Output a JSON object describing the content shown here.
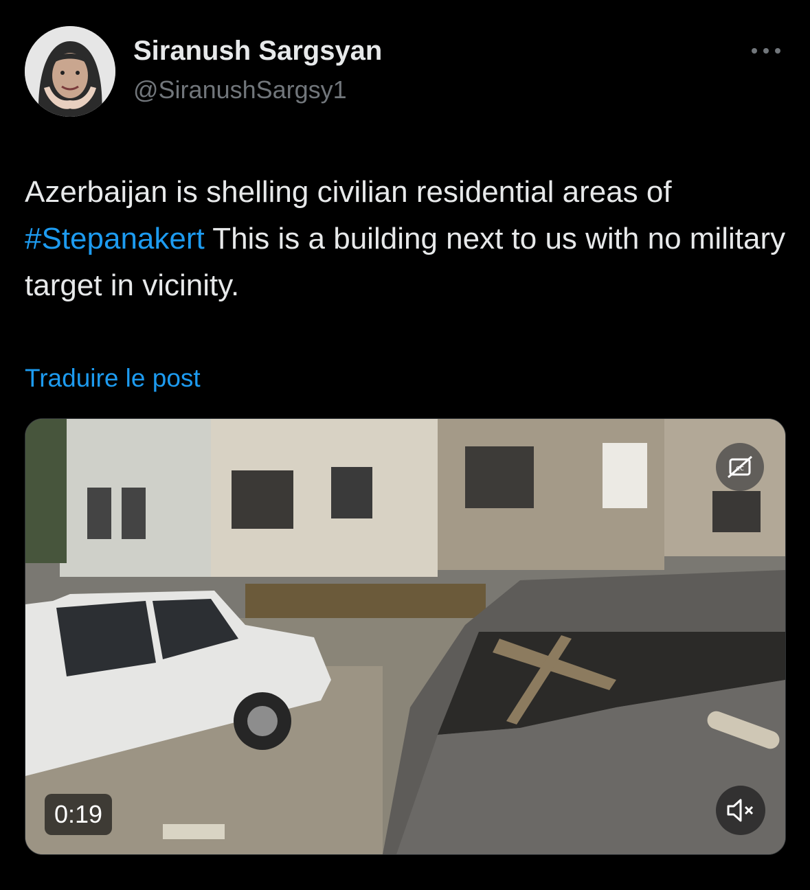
{
  "author": {
    "name": "Siranush Sargsyan",
    "handle": "@SiranushSargsy1"
  },
  "icons": {
    "more": "more-horizontal-icon",
    "captions": "closed-captions-off-icon",
    "mute": "volume-muted-icon"
  },
  "tweet": {
    "text_part1": "Azerbaijan is shelling civilian residential areas of",
    "hashtag": "#Stepanakert",
    "text_part2": "This is a building next to us with no military target in vicinity."
  },
  "translate_label": "Traduire le post",
  "video": {
    "duration": "0:19"
  },
  "colors": {
    "background": "#000000",
    "text": "#e7e9ea",
    "secondary": "#71767b",
    "link": "#1d9bf0"
  }
}
